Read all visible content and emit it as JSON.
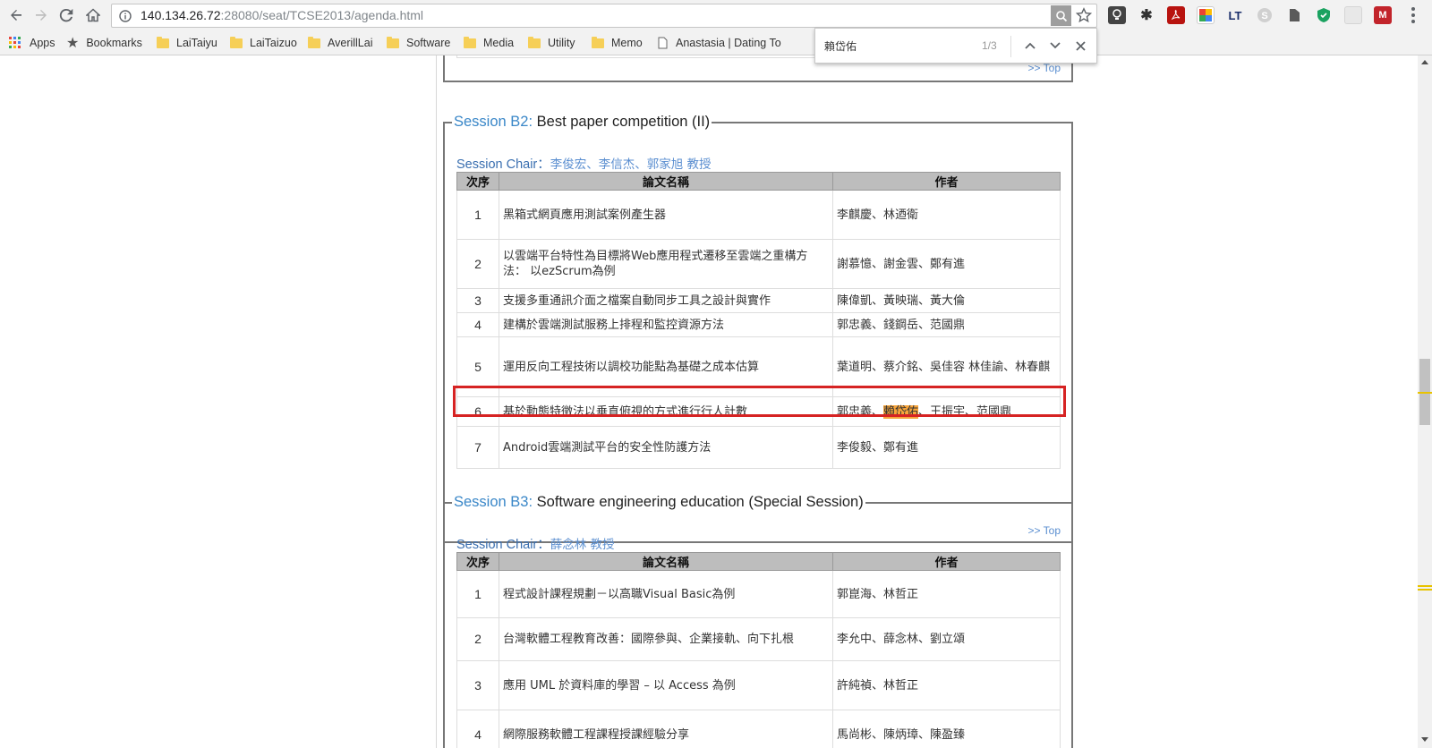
{
  "browser": {
    "url_host": "140.134.26.72",
    "url_port_path": ":28080/seat/TCSE2013/agenda.html",
    "bookmarks": [
      {
        "label": "Apps",
        "icon": "apps-grid-icon"
      },
      {
        "label": "Bookmarks",
        "icon": "star-icon"
      },
      {
        "label": "LaiTaiyu",
        "icon": "folder-icon"
      },
      {
        "label": "LaiTaizuo",
        "icon": "folder-icon"
      },
      {
        "label": "AverillLai",
        "icon": "folder-icon"
      },
      {
        "label": "Software",
        "icon": "folder-icon"
      },
      {
        "label": "Media",
        "icon": "folder-icon"
      },
      {
        "label": "Utility",
        "icon": "folder-icon"
      },
      {
        "label": "Memo",
        "icon": "folder-icon"
      },
      {
        "label": "Anastasia | Dating To",
        "icon": "page-icon"
      }
    ],
    "extensions": [
      "lightbulb",
      "bug",
      "pdf",
      "chrome-ext",
      "LT",
      "skype",
      "evernote",
      "shield",
      "blank",
      "mega"
    ],
    "ext_lt_label": "LT"
  },
  "find": {
    "query": "賴岱佑",
    "count": "1/3"
  },
  "prev_section": {
    "top_link": ">> Top"
  },
  "sessions": [
    {
      "label": "Session B2:",
      "title": "Best paper competition (II)",
      "chair_label": "Session Chair：",
      "chair_names": "李俊宏、李信杰、郭家旭 教授",
      "headers": [
        "次序",
        "論文名稱",
        "作者"
      ],
      "rows": [
        {
          "no": "1",
          "title": "黑箱式網頁應用測試案例產生器",
          "authors": "李麒慶、林迺衛"
        },
        {
          "no": "2",
          "title": "以雲端平台特性為目標將Web應用程式遷移至雲端之重構方法： 以ezScrum為例",
          "authors": "謝慕憶、謝金雲、鄭有進"
        },
        {
          "no": "3",
          "title": "支援多重通訊介面之檔案自動同步工具之設計與實作",
          "authors": "陳偉凱、黃映瑞、黃大倫"
        },
        {
          "no": "4",
          "title": "建構於雲端測試服務上排程和監控資源方法",
          "authors": "郭忠義、錢鋼岳、范國鼎"
        },
        {
          "no": "5",
          "title": "運用反向工程技術以調校功能點為基礎之成本估算",
          "authors": "葉道明、蔡介銘、吳佳容 林佳諭、林春麒"
        },
        {
          "no": "6",
          "title": "基於動態特徵法以垂直俯視的方式進行行人計數",
          "authors_before": "郭忠義、",
          "authors_highlight": "賴岱佑",
          "authors_after": "、王振宇、范國鼎"
        },
        {
          "no": "7",
          "title": "Android雲端測試平台的安全性防護方法",
          "authors": "李俊毅、鄭有進"
        }
      ],
      "top_link": ">> Top"
    },
    {
      "label": "Session B3:",
      "title": "Software engineering education (Special Session)",
      "chair_label": "Session Chair：",
      "chair_names": "薛念林 教授",
      "headers": [
        "次序",
        "論文名稱",
        "作者"
      ],
      "rows": [
        {
          "no": "1",
          "title": "程式設計課程規劃－以高職Visual Basic為例",
          "authors": "郭崑海、林哲正"
        },
        {
          "no": "2",
          "title": "台灣軟體工程教育改善：國際參與、企業接軌、向下扎根",
          "authors": "李允中、薛念林、劉立頌"
        },
        {
          "no": "3",
          "title": "應用 UML 於資料庫的學習 – 以 Access 為例",
          "authors": "許純禎、林哲正"
        },
        {
          "no": "4",
          "title": "網際服務軟體工程課程授課經驗分享",
          "authors": "馬尚彬、陳炳璋、陳盈臻"
        }
      ]
    }
  ],
  "colors": {
    "accent": "#3a87c8",
    "highlight": "#f7a43a",
    "redbox": "#d62323"
  }
}
